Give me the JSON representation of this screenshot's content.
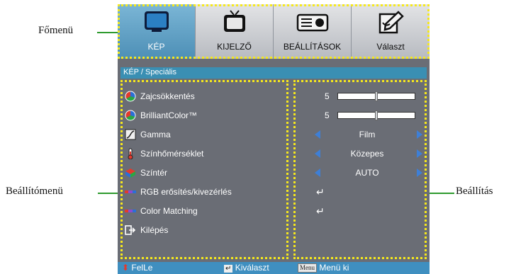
{
  "callouts": {
    "main_menu": "Főmenü",
    "settings_menu": "Beállítómenü",
    "settings": "Beállítás"
  },
  "tabs": [
    {
      "label": "KÉP",
      "icon": "monitor-icon",
      "active": true
    },
    {
      "label": "KIJELZŐ",
      "icon": "tv-icon",
      "active": false
    },
    {
      "label": "BEÁLLÍTÁSOK",
      "icon": "projector-icon",
      "active": false
    },
    {
      "label": "Választ",
      "icon": "edit-icon",
      "active": false
    }
  ],
  "title": "KÉP / Speciális",
  "menu_items": [
    {
      "label": "Zajcsökkentés",
      "icon": "color-wheel-icon"
    },
    {
      "label": "BrilliantColor™",
      "icon": "color-wheel-icon"
    },
    {
      "label": "Gamma",
      "icon": "gamma-curve-icon"
    },
    {
      "label": "Színhőmérséklet",
      "icon": "thermometer-icon"
    },
    {
      "label": "Színtér",
      "icon": "color-cube-icon"
    },
    {
      "label": "RGB erősítés/kivezérlés",
      "icon": "rgb-bar-icon"
    },
    {
      "label": "Color Matching",
      "icon": "rgb-bar-icon"
    },
    {
      "label": "Kilépés",
      "icon": "exit-icon"
    }
  ],
  "settings": {
    "noise_reduction": {
      "value": "5",
      "level": 0.5
    },
    "brilliant_color": {
      "value": "5",
      "level": 0.5
    },
    "gamma": "Film",
    "color_temp": "Közepes",
    "color_space": "AUTO"
  },
  "footer": {
    "updown": "FelLe",
    "select": "Kiválaszt",
    "menu_key": "Menu",
    "menu_exit": "Menü ki"
  },
  "colors": {
    "accent": "#3a8fb3",
    "highlight": "#f6e81c",
    "arrow": "#3e7fd6",
    "panel": "#6a6d75",
    "callout_line": "#2e9a2e"
  }
}
